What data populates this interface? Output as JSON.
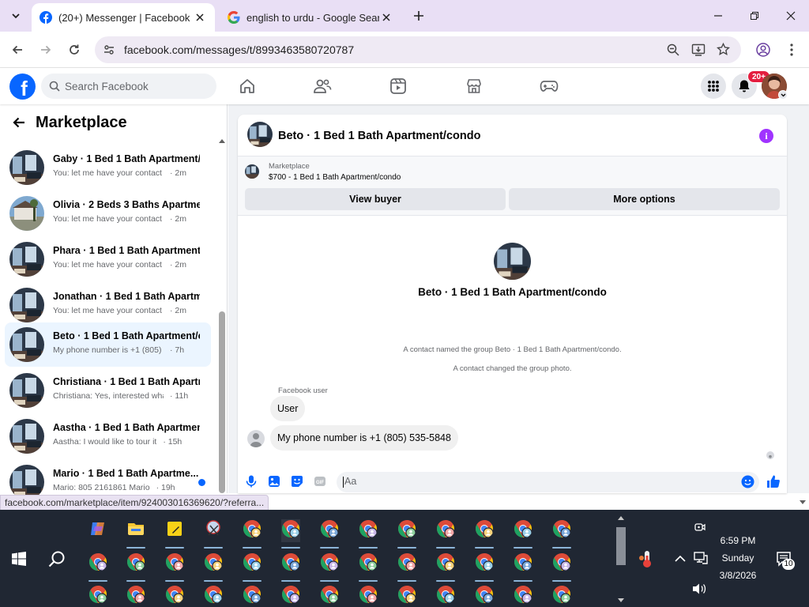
{
  "browser": {
    "tabs": [
      {
        "title": "(20+) Messenger | Facebook",
        "icon": "facebook-icon",
        "active": true
      },
      {
        "title": "english to urdu - Google Search",
        "icon": "google-icon",
        "active": false
      }
    ],
    "url": "facebook.com/messages/t/8993463580720787",
    "status_url": "facebook.com/marketplace/item/924003016369620/?referra..."
  },
  "facebook": {
    "search_placeholder": "Search Facebook",
    "notification_badge": "20+",
    "brand_color": "#0866ff"
  },
  "sidebar": {
    "title": "Marketplace",
    "conversations": [
      {
        "name": "Gaby · 1 Bed 1 Bath Apartment/...",
        "preview": "You: let me have your contact nu...",
        "time": "· 2m",
        "active": false,
        "unread": false
      },
      {
        "name": "Olivia · 2 Beds 3 Baths Apartme...",
        "preview": "You: let me have your contact nu...",
        "time": "· 2m",
        "active": false,
        "unread": false
      },
      {
        "name": "Phara · 1 Bed 1 Bath Apartment/...",
        "preview": "You: let me have your contact nu...",
        "time": "· 2m",
        "active": false,
        "unread": false
      },
      {
        "name": "Jonathan · 1 Bed 1 Bath Apartm...",
        "preview": "You: let me have your contact nu...",
        "time": "· 2m",
        "active": false,
        "unread": false
      },
      {
        "name": "Beto · 1 Bed 1 Bath Apartment/c...",
        "preview": "My phone number is +1 (805) 535...",
        "time": "· 7h",
        "active": true,
        "unread": false
      },
      {
        "name": "Christiana · 1 Bed 1 Bath Apartm...",
        "preview": "Christiana: Yes, interested what is...",
        "time": "· 11h",
        "active": false,
        "unread": false
      },
      {
        "name": "Aastha · 1 Bed 1 Bath Apartmen...",
        "preview": "Aastha: I would like to tour it",
        "time": "· 15h",
        "active": false,
        "unread": false
      },
      {
        "name": "Mario · 1 Bed 1 Bath Apartme...",
        "preview": "Mario: 805 2161861 Mario",
        "time": "· 19h",
        "active": false,
        "unread": true
      }
    ]
  },
  "chat": {
    "title": "Beto · 1 Bed 1 Bath Apartment/condo",
    "marketplace_label": "Marketplace",
    "listing": "$700 - 1 Bed 1 Bath Apartment/condo",
    "view_buyer_label": "View buyer",
    "more_options_label": "More options",
    "center_name": "Beto · 1 Bed 1 Bath Apartment/condo",
    "system_messages": [
      "A contact named the group Beto · 1 Bed 1 Bath Apartment/condo.",
      "A contact changed the group photo."
    ],
    "sender_label": "Facebook user",
    "messages": [
      {
        "text": "User"
      },
      {
        "text": "My phone number is +1 (805) 535-5848"
      }
    ],
    "composer_placeholder": "Aa"
  },
  "taskbar": {
    "time": "6:59 PM",
    "day": "Sunday",
    "date": "3/8/2026",
    "notification_count": "10"
  }
}
